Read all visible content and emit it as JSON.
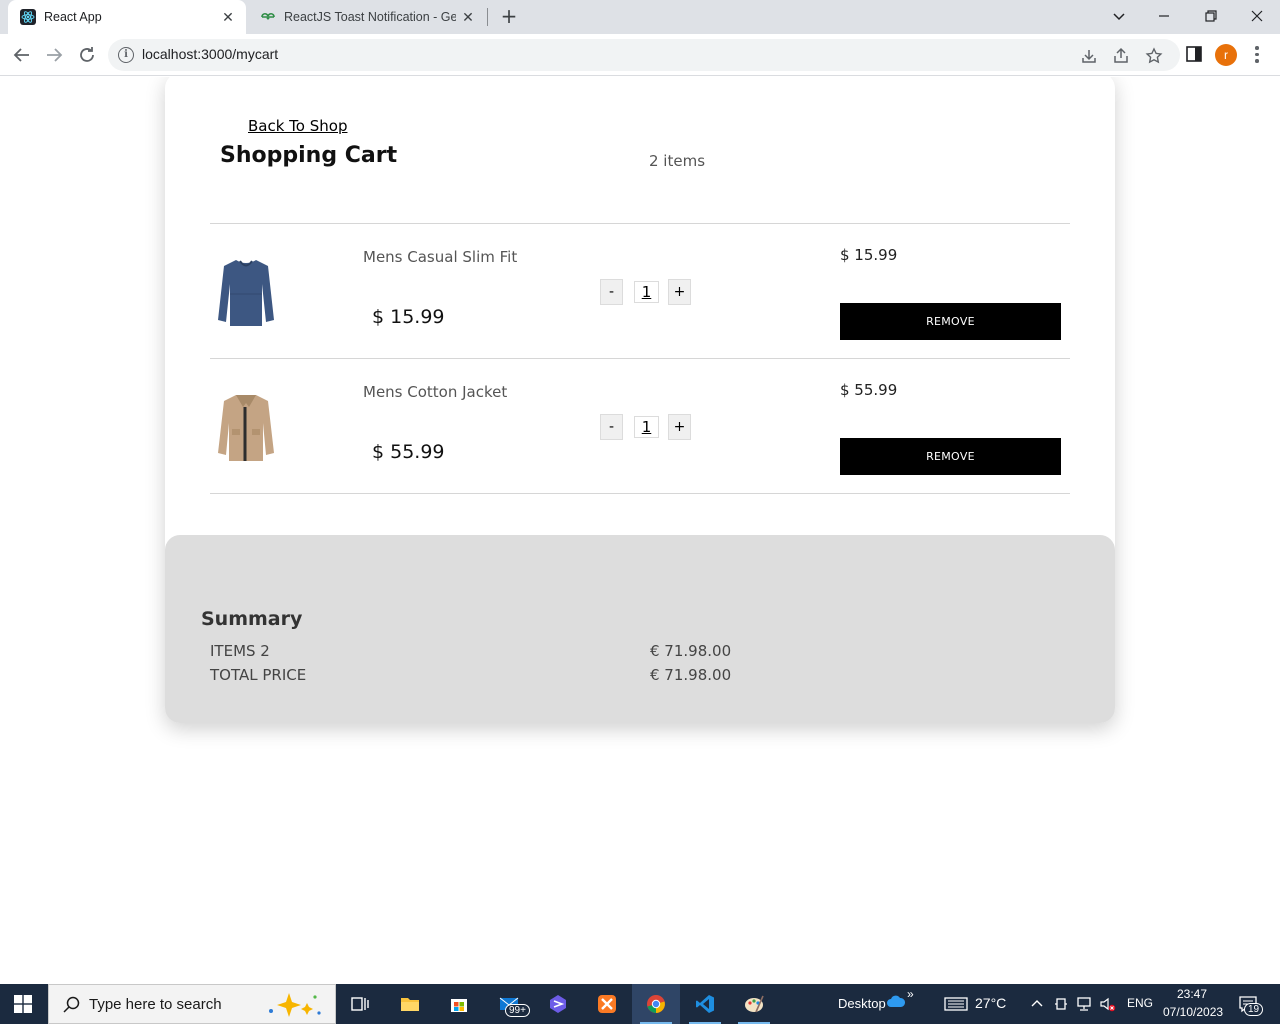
{
  "browser": {
    "tabs": [
      {
        "title": "React App",
        "active": true
      },
      {
        "title": "ReactJS Toast Notification - Gee",
        "active": false
      }
    ],
    "url": "localhost:3000/mycart",
    "profile_initial": "r"
  },
  "cart": {
    "back_label": "Back To Shop",
    "title": "Shopping Cart",
    "items_count": "2 items",
    "items": [
      {
        "name": "Mens Casual Slim Fit",
        "price": "$ 15.99",
        "qty": "1",
        "line_price": "$ 15.99",
        "remove_label": "REMOVE",
        "image": "blue-long-sleeve-shirt"
      },
      {
        "name": "Mens Cotton Jacket",
        "price": "$ 55.99",
        "qty": "1",
        "line_price": "$ 55.99",
        "remove_label": "REMOVE",
        "image": "tan-cotton-jacket"
      }
    ],
    "minus_label": "-",
    "plus_label": "+"
  },
  "summary": {
    "title": "Summary",
    "items_label": "ITEMS 2",
    "items_value": "€ 71.98.00",
    "total_label": "TOTAL PRICE",
    "total_value": "€ 71.98.00"
  },
  "taskbar": {
    "search_placeholder": "Type here to search",
    "desktop_label": "Desktop",
    "weather": "27°C",
    "language": "ENG",
    "time": "23:47",
    "date": "07/10/2023",
    "mail_badge": "99+",
    "notification_count": "19"
  },
  "colors": {
    "tabbar_bg": "#dee1e6",
    "remove_button_bg": "#000000",
    "summary_bg": "#dddddd",
    "taskbar_bg": "#1b2a3f",
    "profile_bg": "#e8710a"
  }
}
